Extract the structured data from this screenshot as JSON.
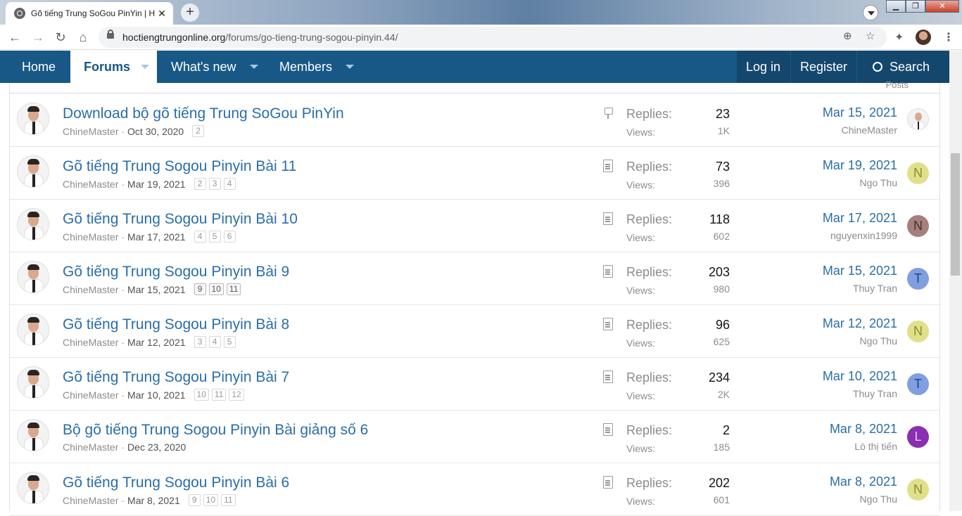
{
  "browser": {
    "tab_title": "Gõ tiếng Trung SoGou PinYin | H",
    "tab_close": "✕",
    "new_tab": "+",
    "url_domain": "hoctiengtrungonline.org",
    "url_path": "/forums/go-tieng-trung-sogou-pinyin.44/",
    "window_min": "▁",
    "window_max": "❐",
    "window_close": "✕"
  },
  "nav": {
    "home": "Home",
    "forums": "Forums",
    "whats_new": "What's new",
    "members": "Members",
    "login": "Log in",
    "register": "Register",
    "search": "Search"
  },
  "list_header": {
    "partial_label": "Posts"
  },
  "threads": [
    {
      "title": "Download bộ gõ tiếng Trung SoGou PinYin",
      "author": "ChineMaster",
      "date": "Oct 30, 2020",
      "pages": [
        "2"
      ],
      "status_icon": "pin-icon",
      "replies": "23",
      "views": "1K",
      "last_date": "Mar 15, 2021",
      "last_user": "ChineMaster",
      "last_avatar": "photo",
      "avatar_letter": "",
      "avatar_bg": "",
      "avatar_fg": ""
    },
    {
      "title": "Gõ tiếng Trung Sogou Pinyin Bài 11",
      "author": "ChineMaster",
      "date": "Mar 19, 2021",
      "pages": [
        "2",
        "3",
        "4"
      ],
      "status_icon": "document-icon",
      "replies": "73",
      "views": "396",
      "last_date": "Mar 19, 2021",
      "last_user": "Ngo Thu",
      "last_avatar": "letter",
      "avatar_letter": "N",
      "avatar_bg": "#e0e08a",
      "avatar_fg": "#8a8a30"
    },
    {
      "title": "Gõ tiếng Trung Sogou Pinyin Bài 10",
      "author": "ChineMaster",
      "date": "Mar 17, 2021",
      "pages": [
        "4",
        "5",
        "6"
      ],
      "status_icon": "document-icon",
      "replies": "118",
      "views": "602",
      "last_date": "Mar 17, 2021",
      "last_user": "nguyenxin1999",
      "last_avatar": "letter",
      "avatar_letter": "N",
      "avatar_bg": "#a57f7b",
      "avatar_fg": "#4a2f2c"
    },
    {
      "title": "Gõ tiếng Trung Sogou Pinyin Bài 9",
      "author": "ChineMaster",
      "date": "Mar 15, 2021",
      "pages": [
        "9",
        "10",
        "11"
      ],
      "pages_style": "dark",
      "status_icon": "document-icon",
      "replies": "203",
      "views": "980",
      "last_date": "Mar 15, 2021",
      "last_user": "Thuy Tran",
      "last_avatar": "letter",
      "avatar_letter": "T",
      "avatar_bg": "#7f9fe0",
      "avatar_fg": "#1f3f80"
    },
    {
      "title": "Gõ tiếng Trung Sogou Pinyin Bài 8",
      "author": "ChineMaster",
      "date": "Mar 12, 2021",
      "pages": [
        "3",
        "4",
        "5"
      ],
      "status_icon": "document-icon",
      "replies": "96",
      "views": "625",
      "last_date": "Mar 12, 2021",
      "last_user": "Ngo Thu",
      "last_avatar": "letter",
      "avatar_letter": "N",
      "avatar_bg": "#e0e08a",
      "avatar_fg": "#8a8a30"
    },
    {
      "title": "Gõ tiếng Trung Sogou Pinyin Bài 7",
      "author": "ChineMaster",
      "date": "Mar 10, 2021",
      "pages": [
        "10",
        "11",
        "12"
      ],
      "status_icon": "document-icon",
      "replies": "234",
      "views": "2K",
      "last_date": "Mar 10, 2021",
      "last_user": "Thuy Tran",
      "last_avatar": "letter",
      "avatar_letter": "T",
      "avatar_bg": "#7f9fe0",
      "avatar_fg": "#1f3f80"
    },
    {
      "title": "Bộ gõ tiếng Trung Sogou Pinyin Bài giảng số 6",
      "author": "ChineMaster",
      "date": "Dec 23, 2020",
      "pages": [],
      "status_icon": "document-icon",
      "replies": "2",
      "views": "185",
      "last_date": "Mar 8, 2021",
      "last_user": "Lò thị tiến",
      "last_avatar": "letter",
      "avatar_letter": "L",
      "avatar_bg": "#8a2fb0",
      "avatar_fg": "#e8c8f5"
    },
    {
      "title": "Gõ tiếng Trung Sogou Pinyin Bài 6",
      "author": "ChineMaster",
      "date": "Mar 8, 2021",
      "pages": [
        "9",
        "10",
        "11"
      ],
      "status_icon": "document-icon",
      "replies": "202",
      "views": "601",
      "last_date": "Mar 8, 2021",
      "last_user": "Ngo Thu",
      "last_avatar": "letter",
      "avatar_letter": "N",
      "avatar_bg": "#e0e08a",
      "avatar_fg": "#8a8a30"
    }
  ],
  "labels": {
    "replies": "Replies:",
    "views": "Views:",
    "separator": "·"
  },
  "colors": {
    "nav_bg": "#185886",
    "nav_right_bg": "#14476d",
    "link": "#2a6ea8"
  }
}
